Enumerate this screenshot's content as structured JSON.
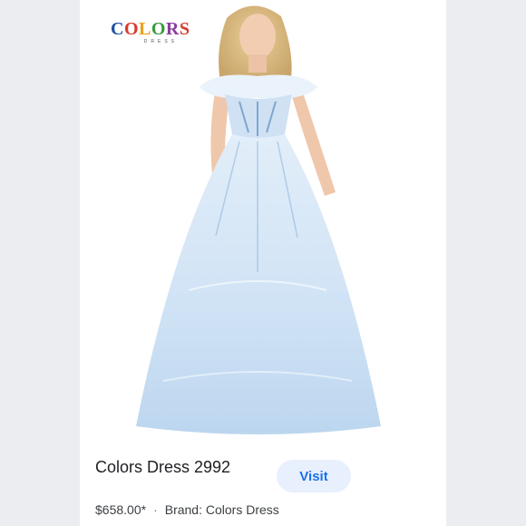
{
  "brand_logo": {
    "letters": [
      {
        "ch": "C",
        "color": "#1e4fa3"
      },
      {
        "ch": "O",
        "color": "#d83b2d"
      },
      {
        "ch": "L",
        "color": "#e9a21b"
      },
      {
        "ch": "O",
        "color": "#3a9a3e"
      },
      {
        "ch": "R",
        "color": "#8a3fa0"
      },
      {
        "ch": "S",
        "color": "#d83b2d"
      }
    ],
    "subtext": "DRESS"
  },
  "product": {
    "title": "Colors Dress 2992",
    "price": "$658.00*",
    "separator": "·",
    "brand": "Brand: Colors Dress"
  },
  "actions": {
    "visit_label": "Visit"
  },
  "colors": {
    "dress_light": "#dcebf8",
    "dress_mid": "#c4dcf2",
    "dress_accent": "#7fa6cf",
    "button_bg": "#e8f0fe",
    "button_text": "#1a73e8"
  }
}
